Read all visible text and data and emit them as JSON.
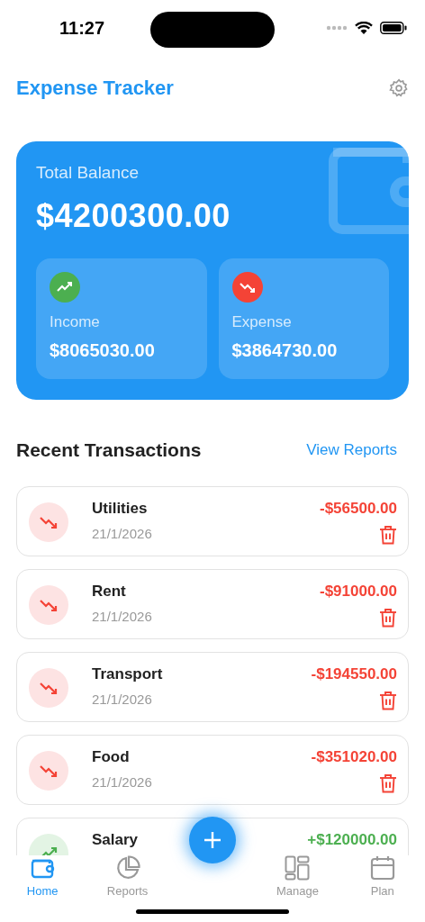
{
  "status_bar": {
    "time": "11:27"
  },
  "header": {
    "title": "Expense Tracker"
  },
  "balance_card": {
    "label": "Total Balance",
    "amount": "$4200300.00",
    "tiles": [
      {
        "kind": "income",
        "label": "Income",
        "amount": "$8065030.00"
      },
      {
        "kind": "expense",
        "label": "Expense",
        "amount": "$3864730.00"
      }
    ]
  },
  "recent": {
    "title": "Recent Transactions",
    "link": "View Reports",
    "transactions": [
      {
        "kind": "expense",
        "name": "Utilities",
        "date": "21/1/2026",
        "amount": "-$56500.00"
      },
      {
        "kind": "expense",
        "name": "Rent",
        "date": "21/1/2026",
        "amount": "-$91000.00"
      },
      {
        "kind": "expense",
        "name": "Transport",
        "date": "21/1/2026",
        "amount": "-$194550.00"
      },
      {
        "kind": "expense",
        "name": "Food",
        "date": "21/1/2026",
        "amount": "-$351020.00"
      },
      {
        "kind": "income",
        "name": "Salary",
        "amount": "+$120000.00"
      }
    ]
  },
  "nav": [
    {
      "label": "Home",
      "selected": true
    },
    {
      "label": "Reports",
      "selected": false
    },
    {
      "label": "Manage",
      "selected": false
    },
    {
      "label": "Plan",
      "selected": false
    }
  ]
}
